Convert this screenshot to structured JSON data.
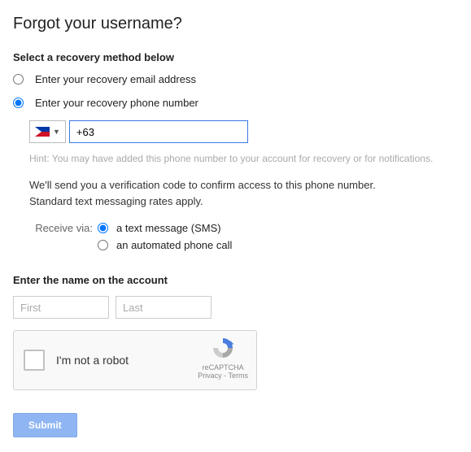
{
  "title": "Forgot your username?",
  "recovery": {
    "heading": "Select a recovery method below",
    "email_label": "Enter your recovery email address",
    "phone_label": "Enter your recovery phone number",
    "selected": "phone"
  },
  "phone": {
    "country_code": "PH",
    "value": "+63",
    "hint": "Hint: You may have added this phone number to your account for recovery or for notifications.",
    "info_line1": "We'll send you a verification code to confirm access to this phone number.",
    "info_line2": "Standard text messaging rates apply."
  },
  "receive": {
    "label": "Receive via:",
    "sms_label": "a text message (SMS)",
    "call_label": "an automated phone call",
    "selected": "sms"
  },
  "name": {
    "heading": "Enter the name on the account",
    "first_placeholder": "First",
    "last_placeholder": "Last"
  },
  "recaptcha": {
    "label": "I'm not a robot",
    "brand": "reCAPTCHA",
    "privacy": "Privacy",
    "terms": "Terms"
  },
  "submit_label": "Submit"
}
